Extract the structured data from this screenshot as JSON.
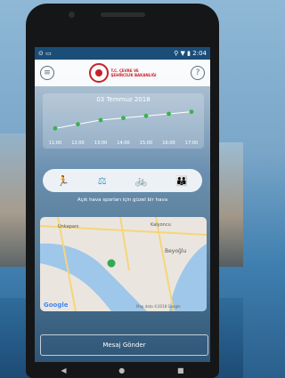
{
  "status": {
    "time": "2:04"
  },
  "header": {
    "menu_icon": "menu-icon",
    "help_label": "?",
    "logo_line1": "T.C. ÇEVRE VE",
    "logo_line2": "ŞEHİRCİLİK BAKANLIĞI"
  },
  "chart": {
    "date": "03 Temmuz 2018",
    "times": [
      "11:00",
      "12:00",
      "13:00",
      "14:00",
      "15:00",
      "16:00",
      "17:00"
    ]
  },
  "chart_data": {
    "type": "line",
    "x": [
      "11:00",
      "12:00",
      "13:00",
      "14:00",
      "15:00",
      "16:00",
      "17:00"
    ],
    "y": [
      1,
      2,
      3,
      3.5,
      4,
      4.5,
      5
    ],
    "title": "03 Temmuz 2018",
    "xlabel": "",
    "ylabel": ""
  },
  "activities": [
    "running-icon",
    "gym-icon",
    "cycling-icon",
    "family-icon"
  ],
  "message": "Açık hava sporları için güzel bir hava",
  "map": {
    "labels": [
      "Unkapanı",
      "Kalyoncu",
      "Beyoğlu",
      "Google"
    ],
    "footer": "Map data ©2018 Google"
  },
  "send_label": "Mesaj Gönder",
  "colors": {
    "status": "#1a4d78",
    "accent": "#3a9bc9",
    "point": "#37b34a",
    "logo": "#c8202a"
  }
}
